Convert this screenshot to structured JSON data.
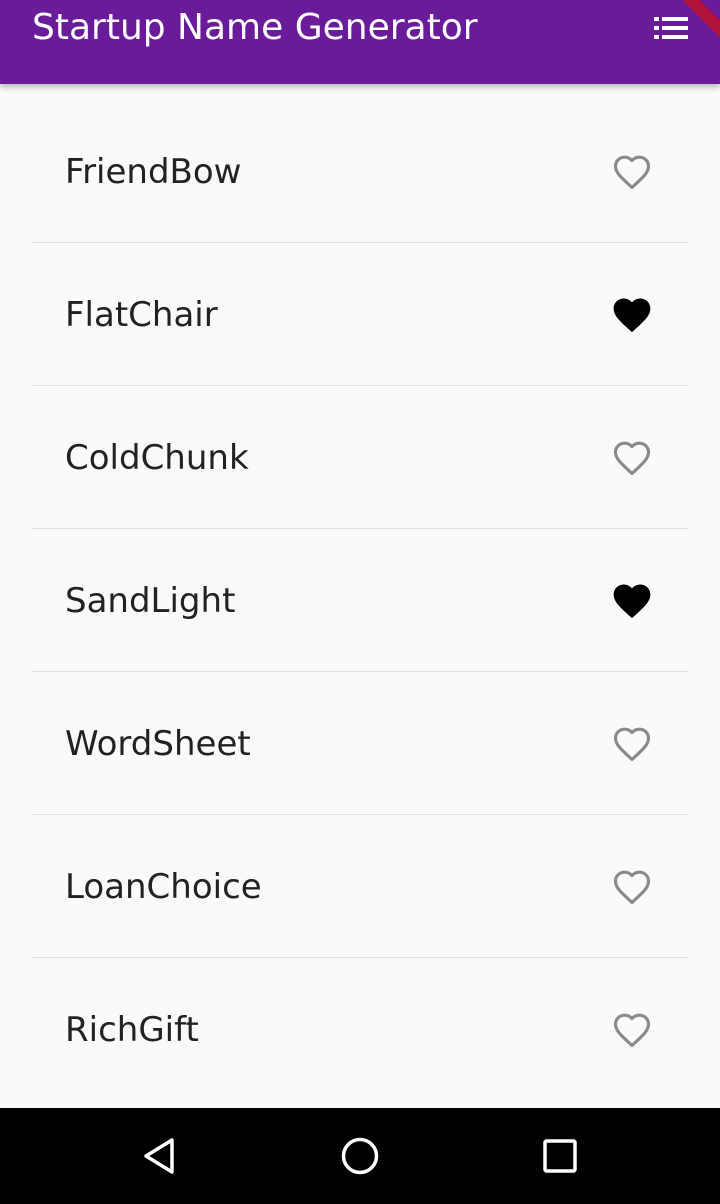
{
  "appbar": {
    "title": "Startup Name Generator",
    "background": "#6a1b9a",
    "action_icon": "list-icon"
  },
  "colors": {
    "heart_outline": "#8a8a8a",
    "heart_filled": "#000000",
    "divider": "#e0e0e0",
    "text": "#222222",
    "background": "#fafafa"
  },
  "items": [
    {
      "name": "FriendBow",
      "saved": false
    },
    {
      "name": "FlatChair",
      "saved": true
    },
    {
      "name": "ColdChunk",
      "saved": false
    },
    {
      "name": "SandLight",
      "saved": true
    },
    {
      "name": "WordSheet",
      "saved": false
    },
    {
      "name": "LoanChoice",
      "saved": false
    },
    {
      "name": "RichGift",
      "saved": false
    }
  ],
  "navbar": {
    "buttons": [
      "back-icon",
      "home-icon",
      "recents-icon"
    ]
  }
}
